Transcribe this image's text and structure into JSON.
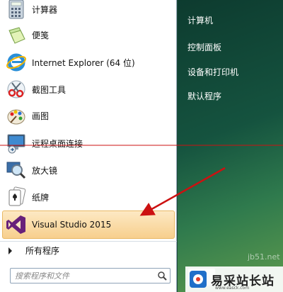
{
  "programs": [
    {
      "label": "计算器",
      "icon": "calculator-icon"
    },
    {
      "label": "便笺",
      "icon": "sticky-notes-icon"
    },
    {
      "label": "Internet Explorer (64 位)",
      "icon": "internet-explorer-icon"
    },
    {
      "label": "截图工具",
      "icon": "snipping-tool-icon"
    },
    {
      "label": "画图",
      "icon": "paint-icon"
    },
    {
      "label": "远程桌面连接",
      "icon": "remote-desktop-icon"
    },
    {
      "label": "放大镜",
      "icon": "magnifier-icon"
    },
    {
      "label": "纸牌",
      "icon": "solitaire-icon"
    },
    {
      "label": "Visual Studio 2015",
      "icon": "visual-studio-icon"
    }
  ],
  "all_programs_label": "所有程序",
  "search": {
    "placeholder": "搜索程序和文件"
  },
  "places": [
    {
      "label": "计算机"
    },
    {
      "label": "控制面板"
    },
    {
      "label": "设备和打印机"
    },
    {
      "label": "默认程序"
    }
  ],
  "watermark": {
    "name": "易采站长站",
    "site": "jb51.net",
    "sub": "www.easck.com"
  },
  "colors": {
    "highlight": "#f7cf8d",
    "annotation_red": "#cc1111",
    "right_pane": "#15533f",
    "vs_purple": "#68217a"
  }
}
